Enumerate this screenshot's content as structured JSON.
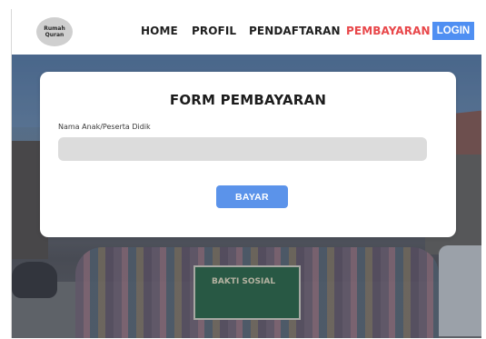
{
  "header": {
    "logo_line1": "Rumah",
    "logo_line2": "Quran",
    "nav": {
      "home": "HOME",
      "profil": "PROFIL",
      "pendaftaran": "PENDAFTARAN",
      "pembayaran": "PEMBAYARAN"
    },
    "login_label": "LOGIN"
  },
  "form": {
    "title": "FORM PEMBAYARAN",
    "field_label": "Nama Anak/Peserta Didik",
    "field_value": "",
    "submit_label": "BAYAR"
  },
  "background": {
    "banner_text": "BAKTI SOSIAL"
  },
  "colors": {
    "accent": "#4f8ff2",
    "active_nav": "#e8474a",
    "button": "#5b93ea"
  }
}
